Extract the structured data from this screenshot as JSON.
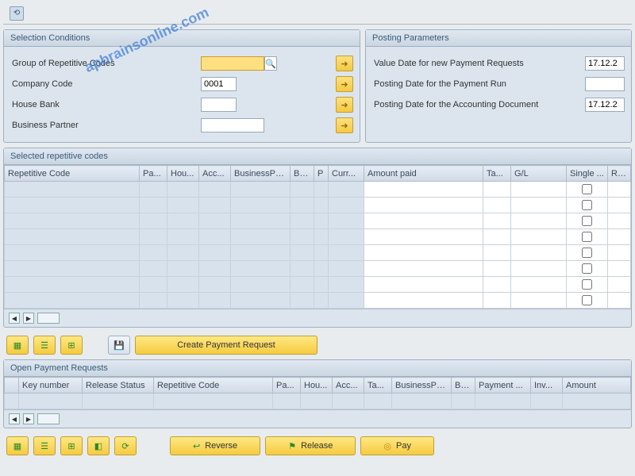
{
  "selection": {
    "title": "Selection Conditions",
    "group_label": "Group of Repetitive Codes",
    "group_value": "",
    "company_label": "Company Code",
    "company_value": "0001",
    "house_label": "House Bank",
    "house_value": "",
    "partner_label": "Business Partner",
    "partner_value": ""
  },
  "posting": {
    "title": "Posting Parameters",
    "value_date_label": "Value Date for new Payment Requests",
    "value_date": "17.12.2",
    "run_date_label": "Posting Date for the Payment Run",
    "run_date": "",
    "acc_date_label": "Posting Date for the Accounting Document",
    "acc_date": "17.12.2"
  },
  "codes_table": {
    "title": "Selected repetitive codes",
    "headers": {
      "rep_code": "Repetitive Code",
      "pa": "Pa...",
      "hou": "Hou...",
      "acc": "Acc...",
      "bp": "BusinessPa...",
      "ba": "Ba...",
      "p": "P",
      "curr": "Curr...",
      "amount": "Amount paid",
      "ta": "Ta...",
      "gl": "G/L",
      "single": "Single ...",
      "ref": "Reference te"
    }
  },
  "open_table": {
    "title": "Open Payment Requests",
    "headers": {
      "key": "Key number",
      "release": "Release Status",
      "rep_code": "Repetitive Code",
      "pa": "Pa...",
      "hou": "Hou...",
      "acc": "Acc...",
      "ta": "Ta...",
      "bp": "BusinessPa...",
      "ba": "Ba...",
      "payment": "Payment ...",
      "inv": "Inv...",
      "amount": "Amount"
    }
  },
  "buttons": {
    "create": "Create Payment Request",
    "reverse": "Reverse",
    "release": "Release",
    "pay": "Pay"
  },
  "watermark": "apbrainsonline.com"
}
